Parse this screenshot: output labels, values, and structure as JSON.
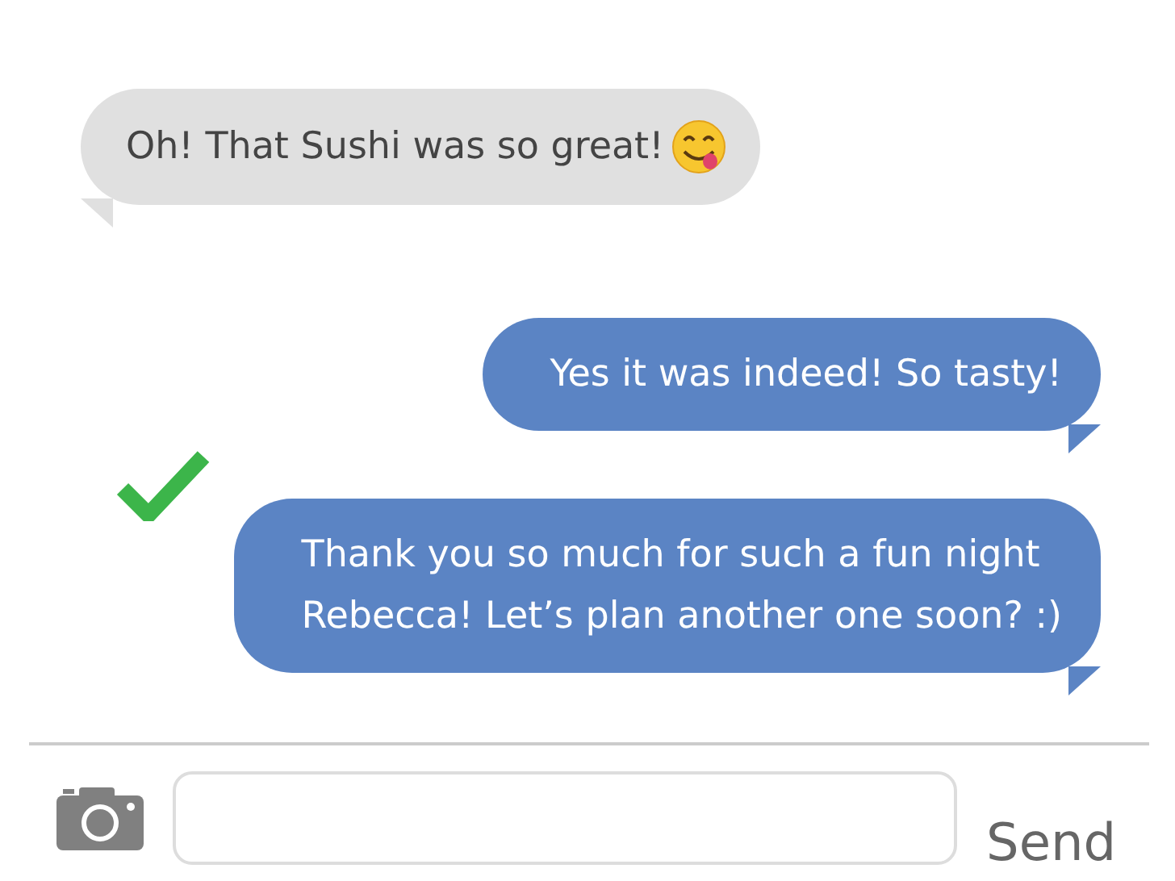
{
  "messages": [
    {
      "kind": "incoming",
      "text": "Oh! That Sushi was so great!",
      "emoji": true,
      "checked": false
    },
    {
      "kind": "outgoing",
      "text": "Yes it was indeed! So tasty!",
      "emoji": false,
      "checked": false
    },
    {
      "kind": "outgoing",
      "text": "Thank you so much for such a fun night\nRebecca! Let’s plan another one soon? :)",
      "emoji": false,
      "checked": true
    }
  ],
  "composer": {
    "send_label": "Send"
  }
}
